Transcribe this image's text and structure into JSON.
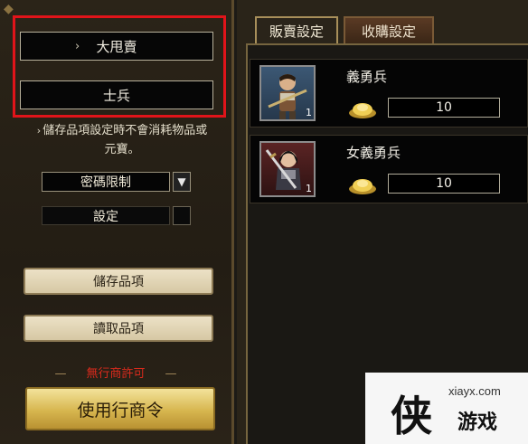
{
  "left_panel": {
    "mode_buttons": [
      {
        "label": "大甩賣",
        "chevron": "›"
      },
      {
        "label": "士兵"
      }
    ],
    "hint_text": "儲存品項設定時不會消耗物品或元寶。",
    "hint_arrow": "›",
    "password_select": {
      "value": "密碼限制",
      "arrow": "▼"
    },
    "setting_label": "設定",
    "save_items_label": "儲存品項",
    "load_items_label": "讀取品項",
    "no_permit_label": "無行商許可",
    "use_merchant_label": "使用行商令"
  },
  "tabs": [
    {
      "label": "販賣設定",
      "active": true
    },
    {
      "label": "收購設定",
      "active": false
    }
  ],
  "units": [
    {
      "name": "義勇兵",
      "count": "1",
      "price": "10",
      "icon": "coin-ingot-icon"
    },
    {
      "name": "女義勇兵",
      "count": "1",
      "price": "10",
      "icon": "coin-ingot-icon"
    }
  ],
  "watermark": {
    "site": "xiayx.com",
    "hero_glyph": "侠",
    "brand": "游戏"
  },
  "colors": {
    "highlight_red": "#e0141a",
    "gold_button": "#d7b64f",
    "alert_red": "#d82a1c"
  }
}
